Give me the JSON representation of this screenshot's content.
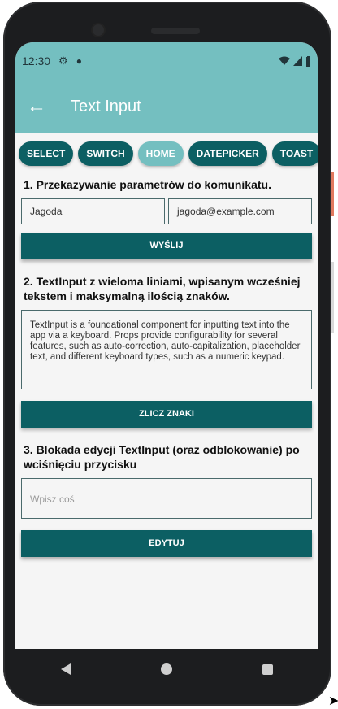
{
  "status_bar": {
    "time": "12:30"
  },
  "app_bar": {
    "title": "Text Input"
  },
  "tabs": [
    "SELECT",
    "SWITCH",
    "HOME",
    "DATEPICKER",
    "TOAST"
  ],
  "section1": {
    "title": "1. Przekazywanie parametrów do komunikatu.",
    "name_value": "Jagoda",
    "email_value": "jagoda@example.com",
    "button_label": "WYŚLIJ"
  },
  "section2": {
    "title": "2. TextInput z wieloma liniami, wpisanym wcześniej tekstem i maksymalną ilością znaków.",
    "multiline_value": "TextInput is a foundational component for inputting text into the app via a keyboard. Props provide configurability for several features, such as auto-correction, auto-capitalization, placeholder text, and different keyboard types, such as a numeric keypad.",
    "button_label": "ZLICZ ZNAKI"
  },
  "section3": {
    "title": "3. Blokada edycji TextInput (oraz odblokowanie) po wciśnięciu przycisku",
    "placeholder": "Wpisz coś",
    "button_label": "EDYTUJ"
  },
  "colors": {
    "primary": "#0c5f63",
    "accent": "#74bfc0"
  }
}
